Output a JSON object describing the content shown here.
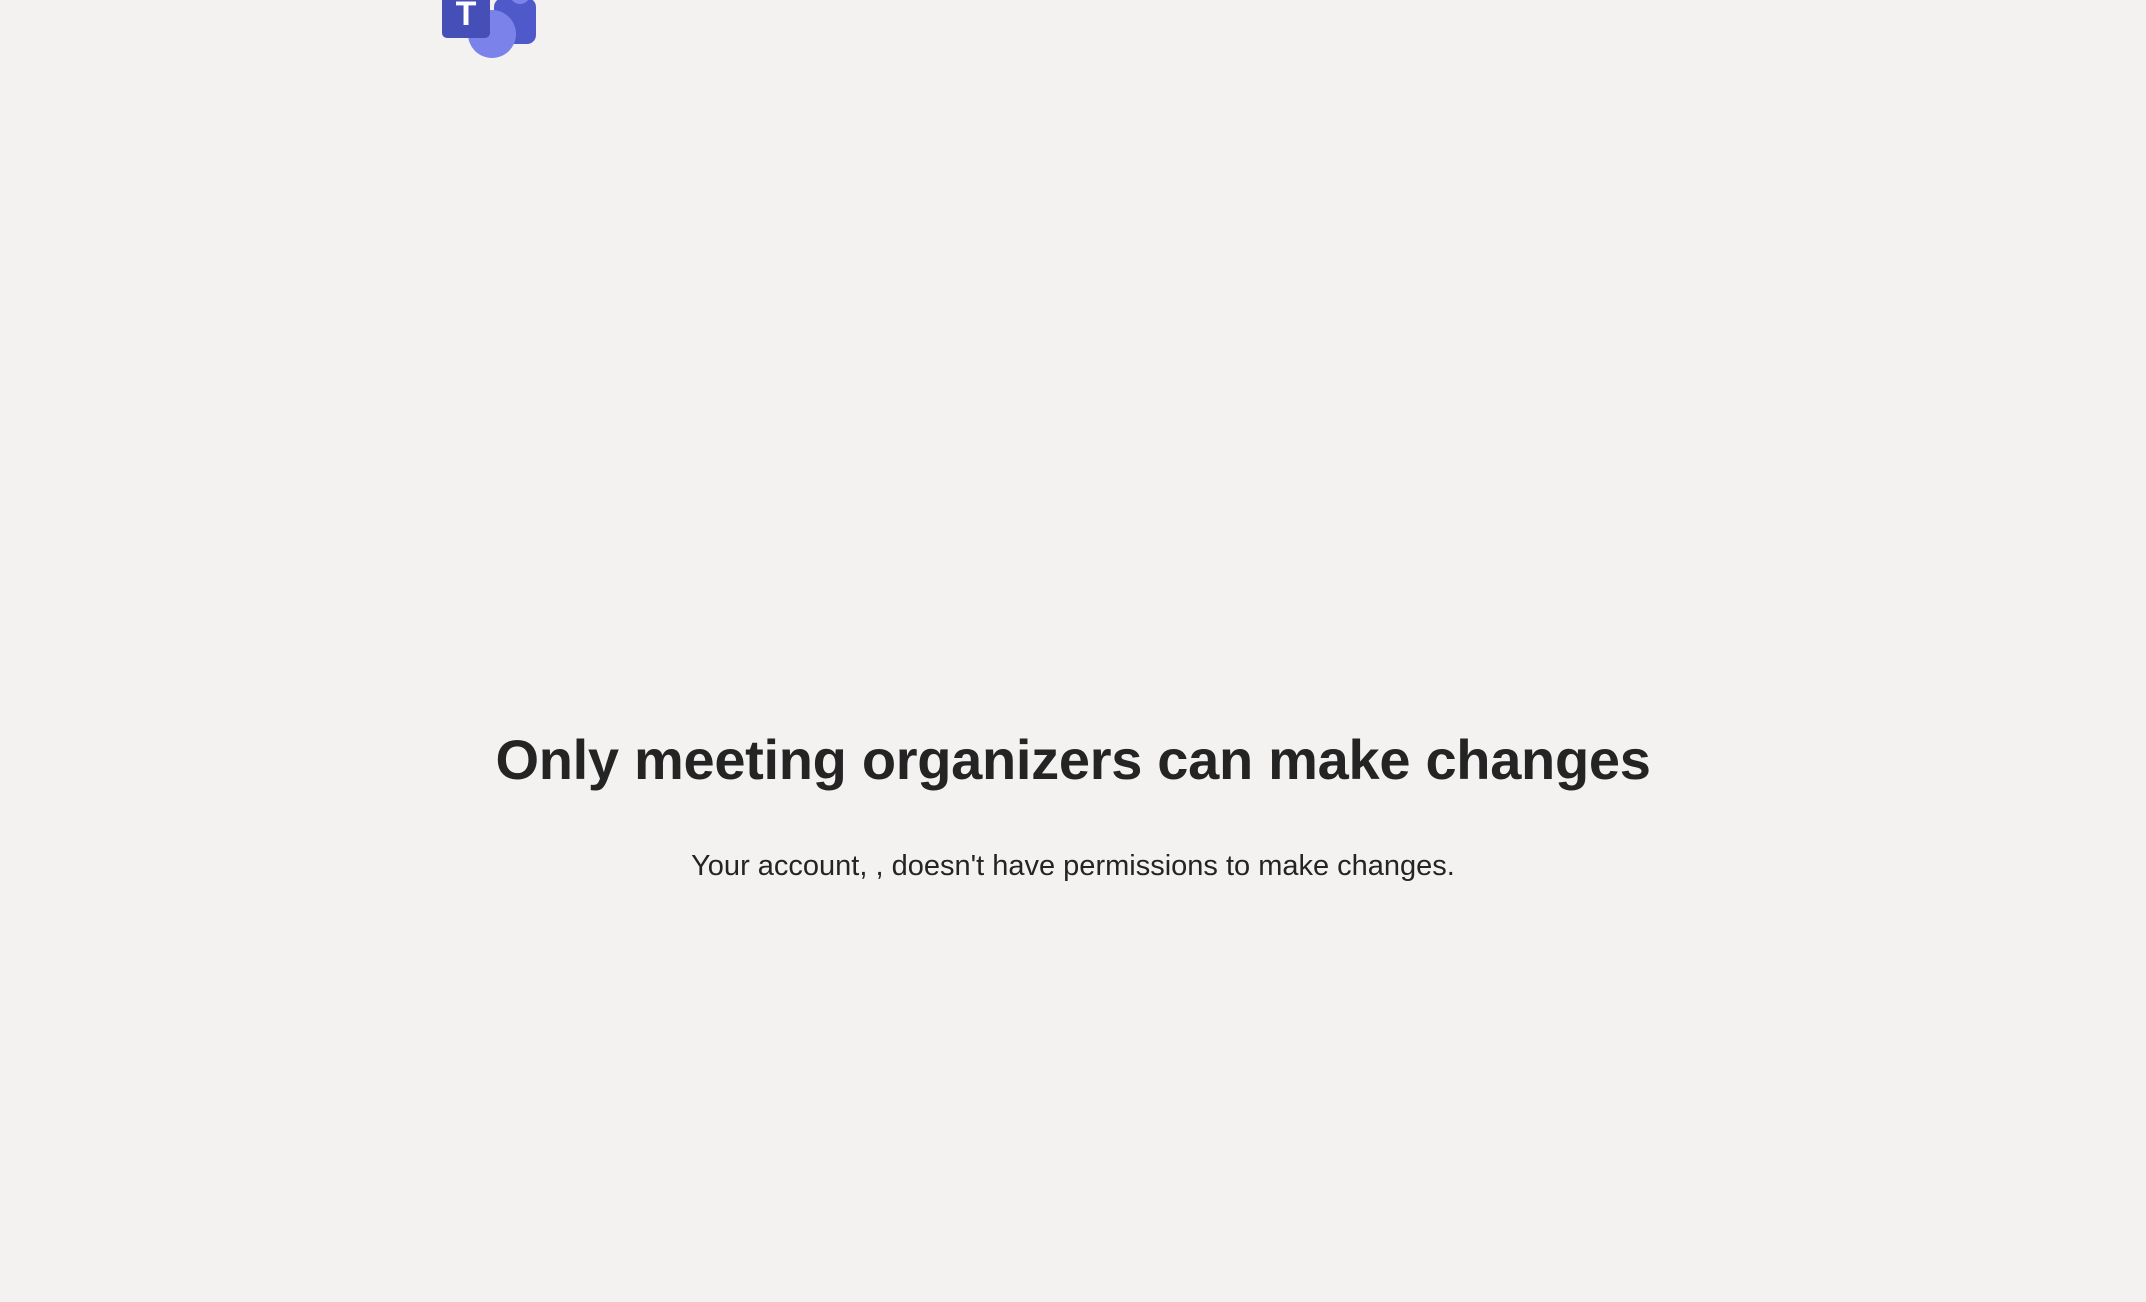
{
  "brand": {
    "logo_icon": "microsoft-teams-logo-icon",
    "logo_letter": "T",
    "colors": {
      "purple_dark": "#464eb8",
      "purple_mid": "#5059c9",
      "purple_light": "#7b83eb"
    }
  },
  "main": {
    "title": "Only meeting organizers can make changes",
    "message": "Your account, , doesn't have permissions to make changes."
  }
}
